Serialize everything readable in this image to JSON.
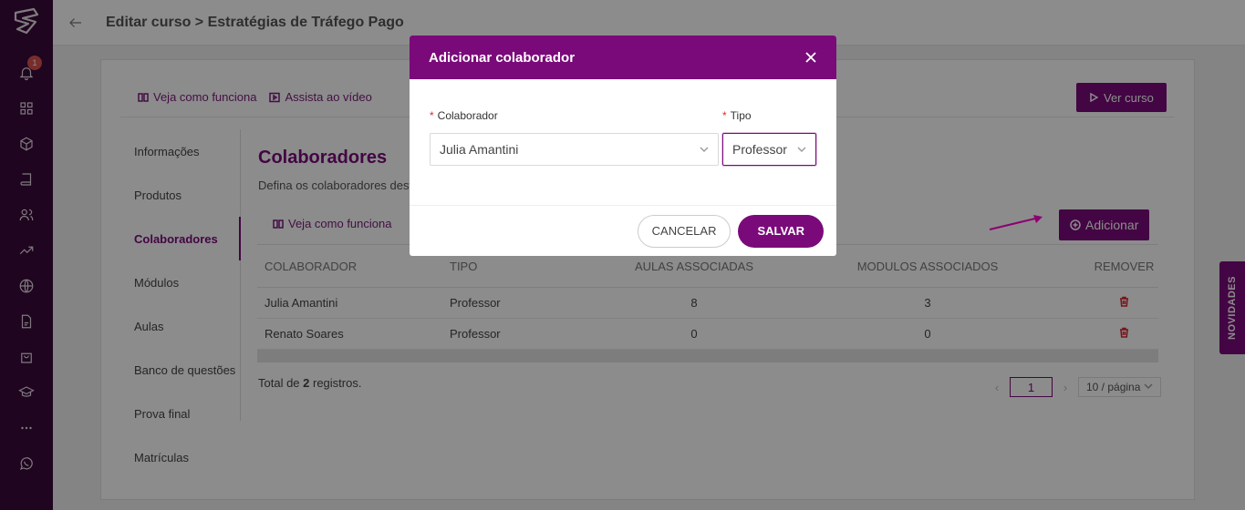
{
  "header": {
    "title": "Editar curso > Estratégias de Tráfego Pago"
  },
  "sidebar": {
    "notification_count": "1",
    "icons": [
      "bell-icon",
      "grid-icon",
      "cube-icon",
      "book-icon",
      "users-icon",
      "trending-icon",
      "globe-icon",
      "file-icon",
      "bag-icon",
      "graduation-icon",
      "more-icon",
      "whatsapp-icon"
    ]
  },
  "toplinks": {
    "how_it_works": "Veja como funciona",
    "watch_video": "Assista ao vídeo"
  },
  "ver_curso": "Ver curso",
  "nav": {
    "items": [
      {
        "label": "Informações"
      },
      {
        "label": "Produtos"
      },
      {
        "label": "Colaboradores"
      },
      {
        "label": "Módulos"
      },
      {
        "label": "Aulas"
      },
      {
        "label": "Banco de questões"
      },
      {
        "label": "Prova final"
      },
      {
        "label": "Matrículas"
      }
    ]
  },
  "section": {
    "title": "Colaboradores",
    "description": "Defina os colaboradores deste",
    "sublink": "Veja como funciona"
  },
  "add_button": "Adicionar",
  "table": {
    "headers": [
      "COLABORADOR",
      "TIPO",
      "AULAS ASSOCIADAS",
      "MODULOS ASSOCIADOS",
      "REMOVER"
    ],
    "rows": [
      {
        "name": "Julia Amantini",
        "type": "Professor",
        "aulas": "8",
        "modulos": "3"
      },
      {
        "name": "Renato Soares",
        "type": "Professor",
        "aulas": "0",
        "modulos": "0"
      }
    ]
  },
  "footer": {
    "total_prefix": "Total de ",
    "total_count": "2",
    "total_suffix": " registros.",
    "current_page": "1",
    "page_size": "10 / página"
  },
  "novidades": "NOVIDADES",
  "modal": {
    "title": "Adicionar colaborador",
    "colaborador_label": "Colaborador",
    "colaborador_value": "Julia Amantini",
    "tipo_label": "Tipo",
    "tipo_value": "Professor",
    "cancel": "CANCELAR",
    "save": "SALVAR"
  },
  "colors": {
    "primary": "#7a0a7a",
    "sidebar": "#3a0a3a",
    "danger": "#d9232d",
    "arrow": "#ff00d0"
  }
}
